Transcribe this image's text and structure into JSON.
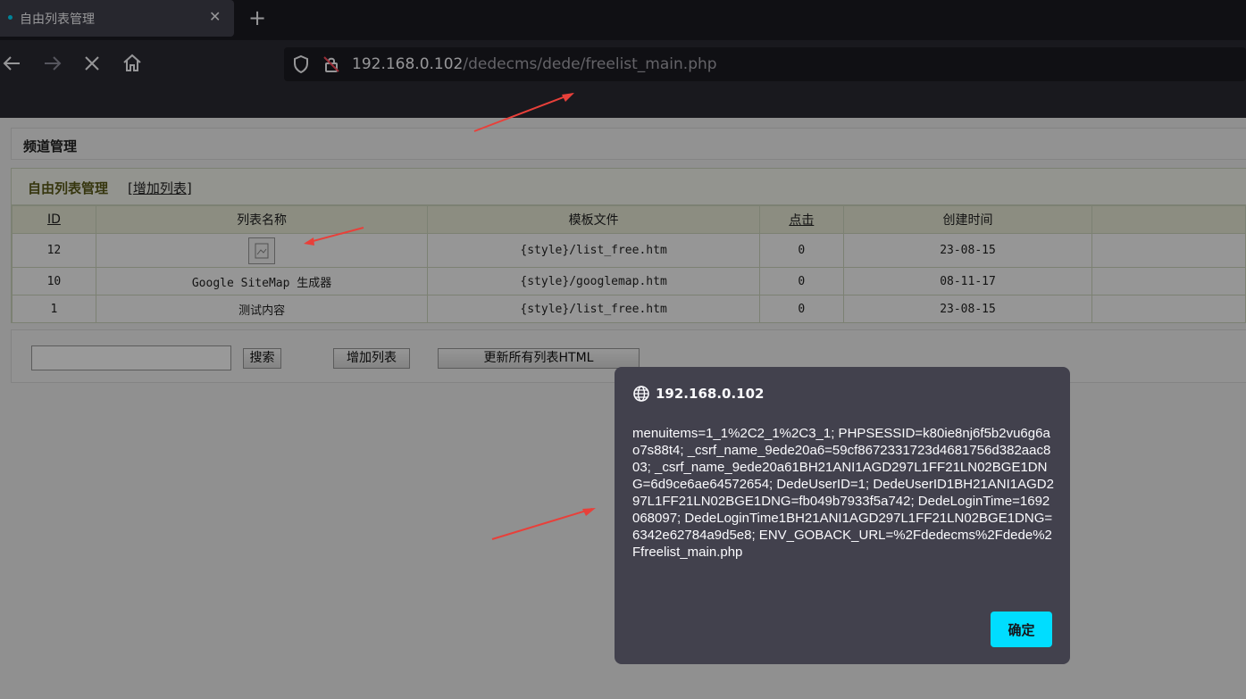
{
  "browser": {
    "tab_title": "自由列表管理",
    "close_glyph": "✕",
    "newtab_glyph": "+",
    "url_host": "192.168.0.102",
    "url_path": "/dedecms/dede/freelist_main.php",
    "icons": [
      "back-icon",
      "forward-icon",
      "stop-icon",
      "home-icon",
      "shield-icon",
      "insecure-lock-icon"
    ]
  },
  "page": {
    "channel_title": "频道管理",
    "list_title": "自由列表管理",
    "add_bracket_open": "[",
    "add_list_link": "增加列表",
    "add_bracket_close": "]",
    "table": {
      "headers": [
        "ID",
        "列表名称",
        "模板文件",
        "点击",
        "创建时间",
        ""
      ],
      "rows": [
        {
          "id": "12",
          "name": "",
          "template": "{style}/list_free.htm",
          "clicks": "0",
          "created": "23-08-15"
        },
        {
          "id": "10",
          "name": "Google SiteMap 生成器",
          "template": "{style}/googlemap.htm",
          "clicks": "0",
          "created": "08-11-17"
        },
        {
          "id": "1",
          "name": "测试内容",
          "template": "{style}/list_free.htm",
          "clicks": "0",
          "created": "23-08-15"
        }
      ]
    },
    "toolbar": {
      "search_value": "",
      "search_button": "搜索",
      "add_button": "增加列表",
      "update_button": "更新所有列表HTML"
    }
  },
  "dialog": {
    "origin": "192.168.0.102",
    "message": "menuitems=1_1%2C2_1%2C3_1; PHPSESSID=k80ie8nj6f5b2vu6g6ao7s88t4; _csrf_name_9ede20a6=59cf8672331723d4681756d382aac803; _csrf_name_9ede20a61BH21ANI1AGD297L1FF21LN02BGE1DNG=6d9ce6ae64572654; DedeUserID=1; DedeUserID1BH21ANI1AGD297L1FF21LN02BGE1DNG=fb049b7933f5a742; DedeLoginTime=1692068097; DedeLoginTime1BH21ANI1AGD297L1FF21LN02BGE1DNG=6342e62784a9d5e8; ENV_GOBACK_URL=%2Fdedecms%2Fdede%2Ffreelist_main.php",
    "ok_label": "确定"
  },
  "colors": {
    "accent": "#00ddff",
    "annotation_arrow": "#e8403a"
  }
}
